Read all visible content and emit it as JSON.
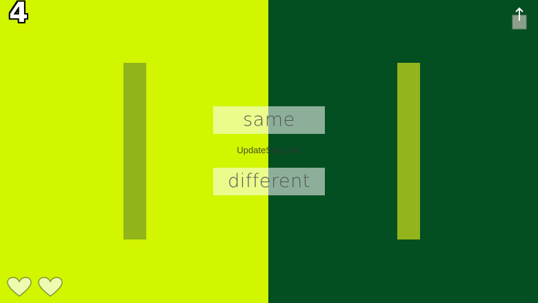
{
  "game": {
    "score": "4",
    "same_label": "same",
    "different_label": "different",
    "watermark": "UpdateStar.com"
  },
  "colors": {
    "left_background": "#d2f500",
    "right_background": "#034f21",
    "left_bar": "#91b41a",
    "right_bar": "#93b41c"
  },
  "icons": {
    "share": "share-icon",
    "life": "heart-icon"
  },
  "lives": {
    "count": 2
  }
}
